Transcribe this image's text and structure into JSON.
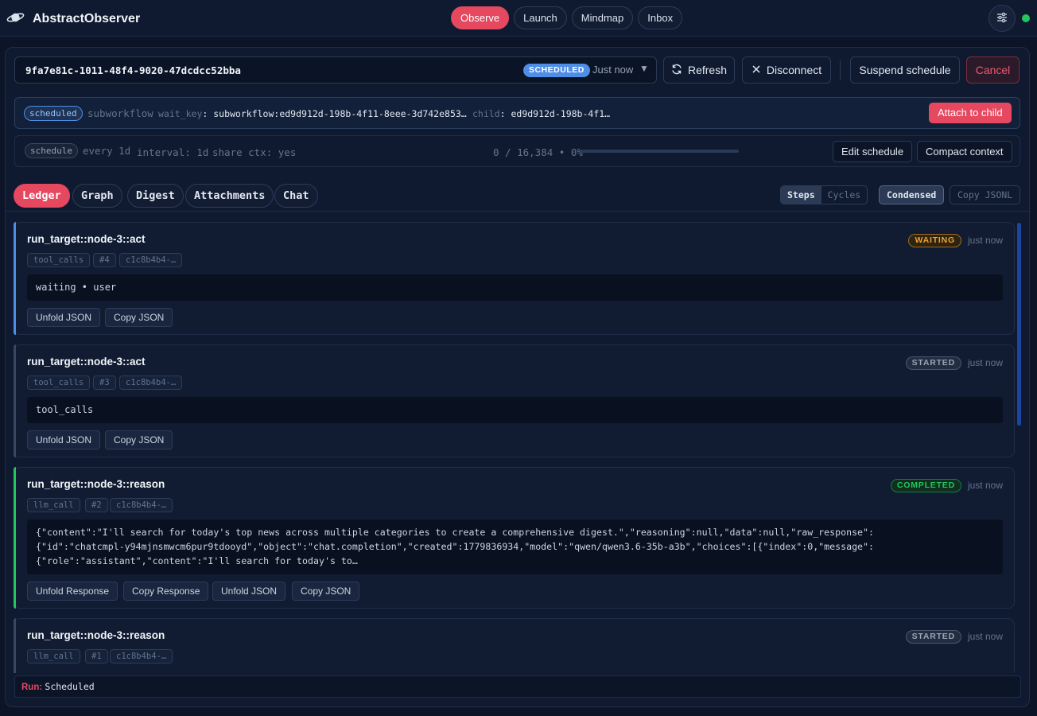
{
  "app": {
    "title": "AbstractObserver"
  },
  "nav": {
    "items": [
      "Observe",
      "Launch",
      "Mindmap",
      "Inbox"
    ],
    "active": "Observe"
  },
  "run": {
    "id": "9fa7e81c-1011-48f4-9020-47dcdcc52bba",
    "status_badge": "SCHEDULED",
    "time": "Just now",
    "refresh": "Refresh",
    "disconnect": "Disconnect",
    "suspend": "Suspend schedule",
    "cancel": "Cancel"
  },
  "wait": {
    "badge": "scheduled",
    "kind": "subworkflow",
    "wait_key_label": "wait_key",
    "wait_key_value": ": subworkflow:ed9d912d-198b-4f11-8eee-3d742e853…",
    "child_label": "child",
    "child_value": ": ed9d912d-198b-4f1…",
    "attach": "Attach to child"
  },
  "schedule": {
    "badge": "schedule",
    "every": "every 1d",
    "interval": "interval: 1d",
    "share": "share ctx: yes",
    "progress_text": "0 / 16,384 • 0%",
    "progress_fraction": 0,
    "edit": "Edit schedule",
    "compact": "Compact context"
  },
  "tabs": [
    "Ledger",
    "Graph",
    "Digest",
    "Attachments",
    "Chat"
  ],
  "active_tab": "Ledger",
  "view": {
    "steps": "Steps",
    "cycles": "Cycles",
    "condensed": "Condensed",
    "copy_jsonl": "Copy JSONL"
  },
  "ledger": [
    {
      "title": "run_target::node-3::act",
      "status": "WAITING",
      "time": "just now",
      "chips": [
        "tool_calls",
        "#4",
        "c1c8b4b4-…"
      ],
      "content": [
        "waiting • user"
      ],
      "buttons": [
        "Unfold JSON",
        "Copy JSON"
      ]
    },
    {
      "title": "run_target::node-3::act",
      "status": "STARTED",
      "time": "just now",
      "chips": [
        "tool_calls",
        "#3",
        "c1c8b4b4-…"
      ],
      "content": [
        "tool_calls"
      ],
      "buttons": [
        "Unfold JSON",
        "Copy JSON"
      ]
    },
    {
      "title": "run_target::node-3::reason",
      "status": "COMPLETED",
      "time": "just now",
      "chips": [
        "llm_call",
        "#2",
        "c1c8b4b4-…"
      ],
      "content": [
        "{\"content\":\"I'll search for today's top news across multiple categories to create a comprehensive digest.\",\"reasoning\":null,\"data\":null,\"raw_response\":",
        "{\"id\":\"chatcmpl-y94mjnsmwcm6pur9tdooyd\",\"object\":\"chat.completion\",\"created\":1779836934,\"model\":\"qwen/qwen3.6-35b-a3b\",\"choices\":[{\"index\":0,\"message\":",
        "{\"role\":\"assistant\",\"content\":\"I'll search for today's to…"
      ],
      "buttons": [
        "Unfold Response",
        "Copy Response",
        "Unfold JSON",
        "Copy JSON"
      ]
    },
    {
      "title": "run_target::node-3::reason",
      "status": "STARTED",
      "time": "just now",
      "chips": [
        "llm_call",
        "#1",
        "c1c8b4b4-…"
      ],
      "content": [],
      "buttons": []
    }
  ],
  "footer": {
    "label": "Run:",
    "value": "Scheduled"
  },
  "colors": {
    "accent": "#e5485f",
    "waiting": "#f0a030",
    "completed": "#22c55e",
    "info": "#4f8ee6"
  }
}
